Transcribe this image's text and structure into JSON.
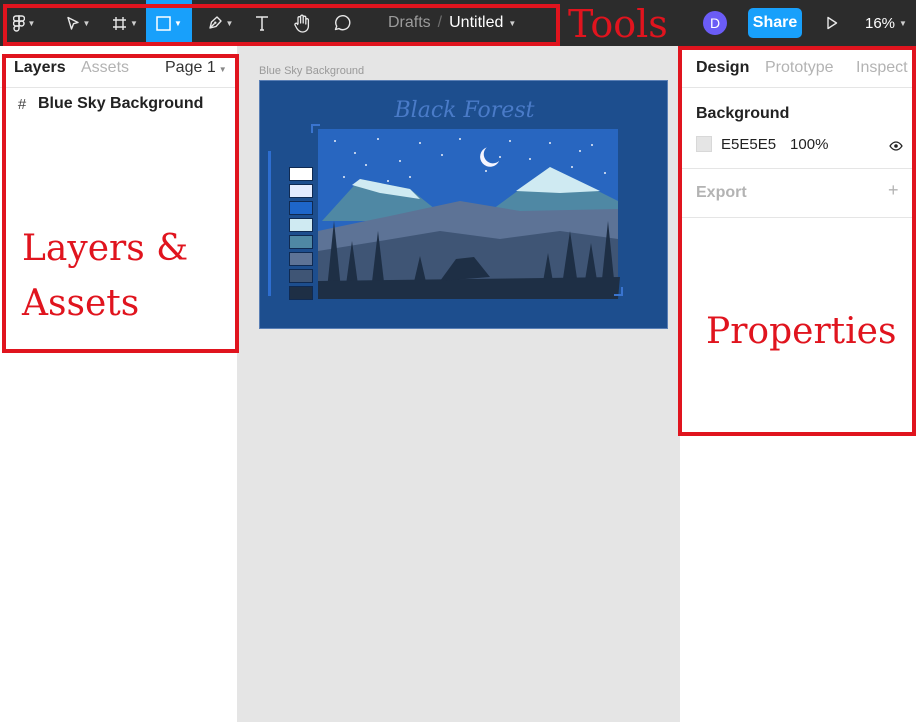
{
  "toolbar": {
    "breadcrumb_drafts": "Drafts",
    "breadcrumb_separator": "/",
    "file_name": "Untitled",
    "avatar_initial": "D",
    "share_label": "Share",
    "zoom": "16%",
    "tools": [
      "figma-menu-icon",
      "move-icon",
      "frame-icon",
      "rectangle-icon",
      "pen-icon",
      "text-icon",
      "hand-icon",
      "comment-icon",
      "present-icon"
    ],
    "accent": "#18a0fb",
    "background": "#2c2c2c"
  },
  "left_panel": {
    "tabs": [
      "Layers",
      "Assets"
    ],
    "active_tab": "Layers",
    "page_selector": "Page 1",
    "layers": [
      {
        "icon": "frame-icon",
        "name": "Blue Sky Background"
      }
    ]
  },
  "canvas": {
    "frame_label": "Blue Sky Background",
    "frame_title": "Black Forest",
    "palette": [
      "#ffffff",
      "#e4ecff",
      "#1e66c9",
      "#cfeaf2",
      "#4f88a4",
      "#5d7396",
      "#3f5575",
      "#1e2f45"
    ],
    "background": "#e5e5e5",
    "frame_color": "#1d4e8e"
  },
  "right_panel": {
    "tabs": [
      "Design",
      "Prototype",
      "Inspect"
    ],
    "active_tab": "Design",
    "background": {
      "title": "Background",
      "hex": "E5E5E5",
      "opacity": "100%"
    },
    "export": {
      "title": "Export"
    }
  },
  "annotations": {
    "tools": "Tools",
    "layers_line1": "Layers &",
    "layers_line2": "Assets",
    "properties": "Properties",
    "color": "#e0141e"
  }
}
